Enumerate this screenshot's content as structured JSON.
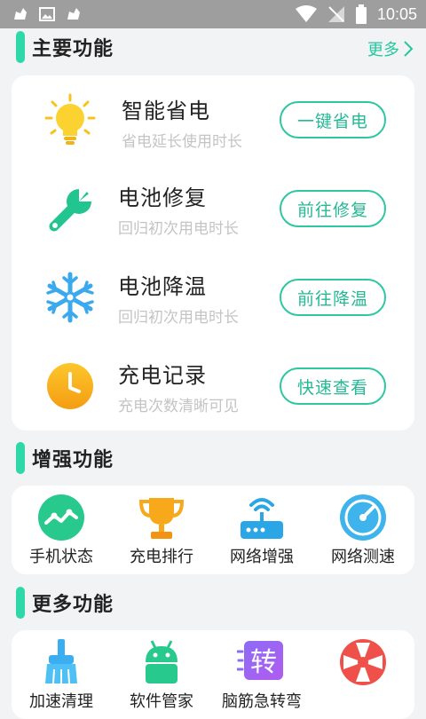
{
  "status_bar": {
    "time": "10:05"
  },
  "main": {
    "title": "主要功能",
    "more_label": "更多",
    "items": [
      {
        "icon": "lightbulb-icon",
        "title": "智能省电",
        "subtitle": "省电延长使用时长",
        "button": "一键省电"
      },
      {
        "icon": "wrench-icon",
        "title": "电池修复",
        "subtitle": "回归初次用电时长",
        "button": "前往修复"
      },
      {
        "icon": "snowflake-icon",
        "title": "电池降温",
        "subtitle": "回归初次用电时长",
        "button": "前往降温"
      },
      {
        "icon": "clock-icon",
        "title": "充电记录",
        "subtitle": "充电次数清晰可见",
        "button": "快速查看"
      }
    ]
  },
  "enhance": {
    "title": "增强功能",
    "items": [
      {
        "icon": "phone-status-icon",
        "label": "手机状态"
      },
      {
        "icon": "trophy-icon",
        "label": "充电排行"
      },
      {
        "icon": "router-icon",
        "label": "网络增强"
      },
      {
        "icon": "speedometer-icon",
        "label": "网络测速"
      }
    ]
  },
  "more": {
    "title": "更多功能",
    "items": [
      {
        "icon": "broom-icon",
        "label": "加速清理"
      },
      {
        "icon": "android-icon",
        "label": "软件管家"
      },
      {
        "icon": "zhuan-icon",
        "label": "脑筋急转弯",
        "glyph": "转"
      },
      {
        "icon": "wheel-icon",
        "label": ""
      }
    ]
  },
  "colors": {
    "accent": "#2ed8a8",
    "button_text": "#26b894",
    "subtitle": "#c4c4c4"
  }
}
